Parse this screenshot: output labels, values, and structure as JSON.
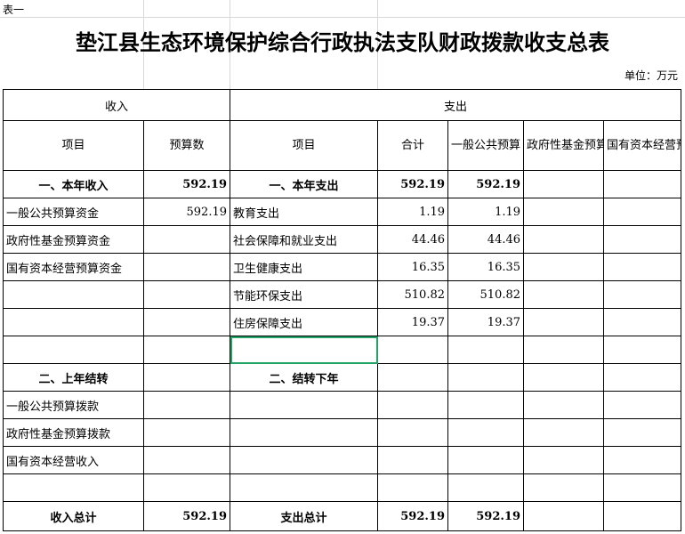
{
  "sheet_label": "表一",
  "title": "垫江县生态环境保护综合行政执法支队财政拨款收支总表",
  "unit": "单位：万元",
  "header": {
    "income": "收入",
    "expense": "支出",
    "item": "项目",
    "budget": "预算数",
    "exp_item": "项目",
    "total": "合计",
    "general": "一般公共预算",
    "fund": "政府性基金预算",
    "state": "国有资本经营预算"
  },
  "rows": [
    {
      "in_item": "一、本年收入",
      "in_val": "592.19",
      "ex_item": "一、本年支出",
      "total": "592.19",
      "general": "592.19",
      "fund": "",
      "state": "",
      "bold": true
    },
    {
      "in_item": "一般公共预算资金",
      "in_val": "592.19",
      "ex_item": "教育支出",
      "total": "1.19",
      "general": "1.19",
      "fund": "",
      "state": ""
    },
    {
      "in_item": "政府性基金预算资金",
      "in_val": "",
      "ex_item": "社会保障和就业支出",
      "total": "44.46",
      "general": "44.46",
      "fund": "",
      "state": ""
    },
    {
      "in_item": "国有资本经营预算资金",
      "in_val": "",
      "ex_item": "卫生健康支出",
      "total": "16.35",
      "general": "16.35",
      "fund": "",
      "state": ""
    },
    {
      "in_item": "",
      "in_val": "",
      "ex_item": "节能环保支出",
      "total": "510.82",
      "general": "510.82",
      "fund": "",
      "state": ""
    },
    {
      "in_item": "",
      "in_val": "",
      "ex_item": "住房保障支出",
      "total": "19.37",
      "general": "19.37",
      "fund": "",
      "state": ""
    },
    {
      "in_item": "",
      "in_val": "",
      "ex_item": "",
      "total": "",
      "general": "",
      "fund": "",
      "state": "",
      "selected": true
    },
    {
      "in_item": "二、上年结转",
      "in_val": "",
      "ex_item": "二、结转下年",
      "total": "",
      "general": "",
      "fund": "",
      "state": "",
      "bold": true
    },
    {
      "in_item": "一般公共预算拨款",
      "in_val": "",
      "ex_item": "",
      "total": "",
      "general": "",
      "fund": "",
      "state": ""
    },
    {
      "in_item": "政府性基金预算拨款",
      "in_val": "",
      "ex_item": "",
      "total": "",
      "general": "",
      "fund": "",
      "state": ""
    },
    {
      "in_item": "国有资本经营收入",
      "in_val": "",
      "ex_item": "",
      "total": "",
      "general": "",
      "fund": "",
      "state": ""
    },
    {
      "in_item": "",
      "in_val": "",
      "ex_item": "",
      "total": "",
      "general": "",
      "fund": "",
      "state": ""
    }
  ],
  "totals": {
    "in_label": "收入总计",
    "in_val": "592.19",
    "ex_label": "支出总计",
    "total": "592.19",
    "general": "592.19",
    "fund": "",
    "state": ""
  }
}
